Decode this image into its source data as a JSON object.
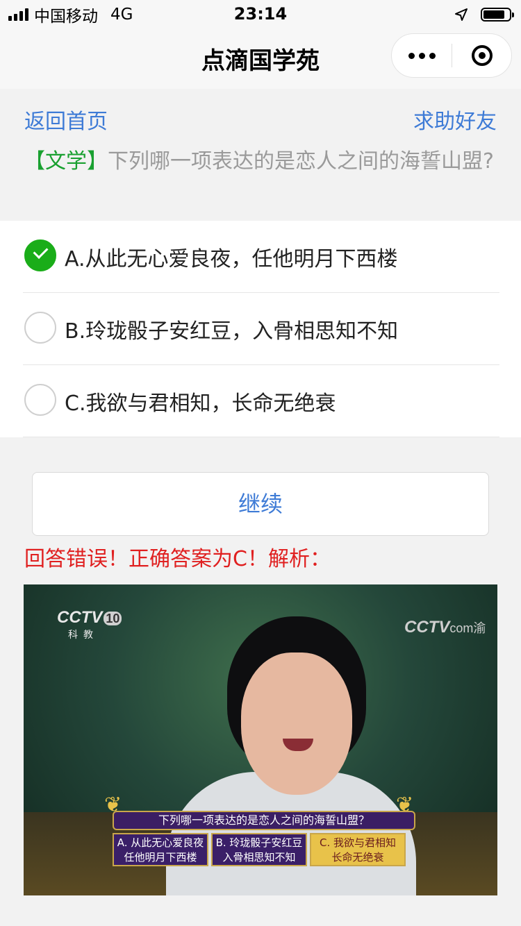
{
  "status_bar": {
    "carrier": "中国移动",
    "network": "4G",
    "time": "23:14"
  },
  "nav": {
    "title": "点滴国学苑"
  },
  "links": {
    "home": "返回首页",
    "help": "求助好友"
  },
  "question": {
    "category": "【文学】",
    "text": "下列哪一项表达的是恋人之间的海誓山盟?"
  },
  "options": [
    {
      "label": "A.从此无心爱良夜，任他明月下西楼",
      "selected": true
    },
    {
      "label": "B.玲珑骰子安红豆，入骨相思知不知",
      "selected": false
    },
    {
      "label": "C.我欲与君相知，长命无绝衰",
      "selected": false
    }
  ],
  "continue_label": "继续",
  "result_text": "回答错误！正确答案为C！解析：",
  "video": {
    "channel_logo": "CCTV",
    "channel_number": "10",
    "channel_sub": "科教",
    "site_logo": "CCTV",
    "site_logo_suffix": "com",
    "site_logo_mark": "渝",
    "question": "下列哪一项表达的是恋人之间的海誓山盟？",
    "options": [
      {
        "line1": "A. 从此无心爱良夜",
        "line2": "任他明月下西楼"
      },
      {
        "line1": "B. 玲珑骰子安红豆",
        "line2": "入骨相思知不知"
      },
      {
        "line1": "C. 我欲与君相知",
        "line2": "长命无绝衰"
      }
    ]
  },
  "colors": {
    "link": "#3e7bd6",
    "category": "#19a030",
    "error": "#e02020",
    "checked": "#1aad19"
  }
}
